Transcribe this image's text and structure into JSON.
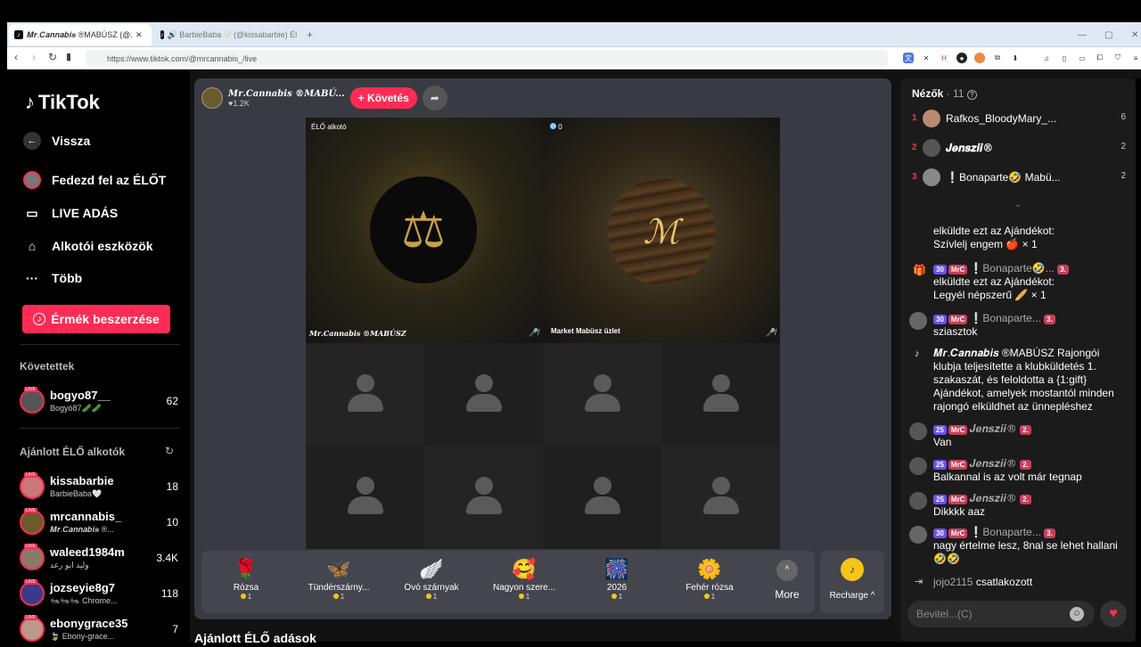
{
  "browser": {
    "tabs": [
      {
        "label": "𝑴𝒓.𝑪𝒂𝒏𝒏𝒂𝒃𝒊𝒔 ®MABÚSZ (@...",
        "close": "✕"
      },
      {
        "label": "🔊 BarbieBaba🤍 (@kissabarbie) Él..."
      }
    ],
    "new_tab": "+",
    "url": "https://www.tiktok.com/@mrcannabis_/live"
  },
  "sidebar": {
    "logo": "TikTok",
    "back_label": "Vissza",
    "nav": [
      {
        "label": "Fedezd fel az ÉLŐT",
        "icon": "explore-icon"
      },
      {
        "label": "LIVE ADÁS",
        "icon": "video-icon"
      },
      {
        "label": "Alkotói eszközök",
        "icon": "creator-tools-icon"
      },
      {
        "label": "Több",
        "icon": "more-icon"
      }
    ],
    "coins_button": "Érmék beszerzése",
    "followed_title": "Követettek",
    "followed": [
      {
        "name": "bogyo87__",
        "sub": "Bogyó87🥒🥒",
        "count": "62"
      }
    ],
    "recommended_title": "Ajánlott ÉLŐ alkotók",
    "recommended": [
      {
        "name": "kissabarbie",
        "sub": "BarbieBaba🤍",
        "count": "18"
      },
      {
        "name": "mrcannabis_",
        "sub": "𝑴𝒓.𝑪𝒂𝒏𝒏𝒂𝒃𝒊𝒔 ®...",
        "count": "10"
      },
      {
        "name": "waleed1984m",
        "sub": "وليد ابو رعد",
        "count": "3.4K"
      },
      {
        "name": "jozseyie8g7",
        "sub": "🐜🐜🐜 Chrome...",
        "count": "118"
      },
      {
        "name": "ebonygrace35",
        "sub": "🍃 Ebony-grace...",
        "count": "7"
      }
    ],
    "live_tag": "LIVE"
  },
  "stage": {
    "host_name": "𝑴𝒓.𝑪𝒂𝒏𝒏𝒂𝒃𝒊𝒔 ®MABÚ...",
    "host_likes": "♥1.2K",
    "follow_label": "+ Követés",
    "tile1_tag": "ÉLŐ alkotó",
    "tile1_name": "𝑴𝒓.𝑪𝒂𝒏𝒏𝒂𝒃𝒊𝒔 ®MABÚSZ",
    "tile2_viewers": "0",
    "tile2_name": "Market Mabüsz üzlet",
    "gifts": [
      {
        "icon": "🌹",
        "name": "Rózsa",
        "price": "1"
      },
      {
        "icon": "🦋",
        "name": "Tündérszárny...",
        "price": "1"
      },
      {
        "icon": "🪽",
        "name": "Óvó szárnyak",
        "price": "1"
      },
      {
        "icon": "🥰",
        "name": "Nagyon szere...",
        "price": "1"
      },
      {
        "icon": "🎆",
        "name": "2026",
        "price": "1"
      },
      {
        "icon": "🌼",
        "name": "Fehér rózsa",
        "price": "1"
      }
    ],
    "more_label": "More",
    "recharge_label": "Recharge ^",
    "recommended_heading": "Ajánlott ÉLŐ adások"
  },
  "panel": {
    "viewers_title": "Nézők",
    "viewers_count": "· 11",
    "viewers": [
      {
        "rank": "1",
        "name": "Rafkos_BloodyMary_...",
        "score": "6"
      },
      {
        "rank": "2",
        "name": "𝑱𝒆𝒏𝒔𝒛𝒊𝒊®",
        "score": "2"
      },
      {
        "rank": "3",
        "name": "❕Bonaparte🤣 Mabü...",
        "score": "2"
      }
    ],
    "chat": [
      {
        "head": "",
        "text": "elküldte ezt az Ajándékot:",
        "text2": " Szívlelj engem 🍎 × 1"
      },
      {
        "level": "30",
        "fan": "MrC",
        "user": "❕Bonaparte🤣...",
        "sub": "3.",
        "text": "elküldte ezt az Ajándékot:",
        "text2": " Legyél népszerű 🥖 × 1"
      },
      {
        "level": "30",
        "fan": "MrC",
        "user": "❕Bonaparte...",
        "sub": "3.",
        "text": "sziasztok"
      },
      {
        "text": "𝑴𝒓.𝑪𝒂𝒏𝒏𝒂𝒃𝒊𝒔 ®MABÚSZ Rajongói klubja teljesítette a klubküldetés 1. szakaszát, és feloldotta a {1:gift} Ajándékot, amelyek mostantól minden rajongó elküldhet az ünnepléshez"
      },
      {
        "level": "25",
        "fan": "MrC",
        "user": "𝑱𝒆𝒏𝒔𝒛𝒊𝒊®",
        "sub": "2.",
        "text": "Van"
      },
      {
        "level": "25",
        "fan": "MrC",
        "user": "𝑱𝒆𝒏𝒔𝒛𝒊𝒊®",
        "sub": "2.",
        "text": "Balkannal is az volt már tegnap"
      },
      {
        "level": "25",
        "fan": "MrC",
        "user": "𝑱𝒆𝒏𝒔𝒛𝒊𝒊®",
        "sub": "2.",
        "text": "Dikkkk aaz"
      },
      {
        "level": "30",
        "fan": "MrC",
        "user": "❕Bonaparte...",
        "sub": "3.",
        "text": "nagy értelme lesz, 8nal se lehet hallani 🤣🤣"
      },
      {
        "user": "jojo2115",
        "text": "csatlakozott"
      }
    ],
    "input_placeholder": "Bevitel...(C)"
  }
}
